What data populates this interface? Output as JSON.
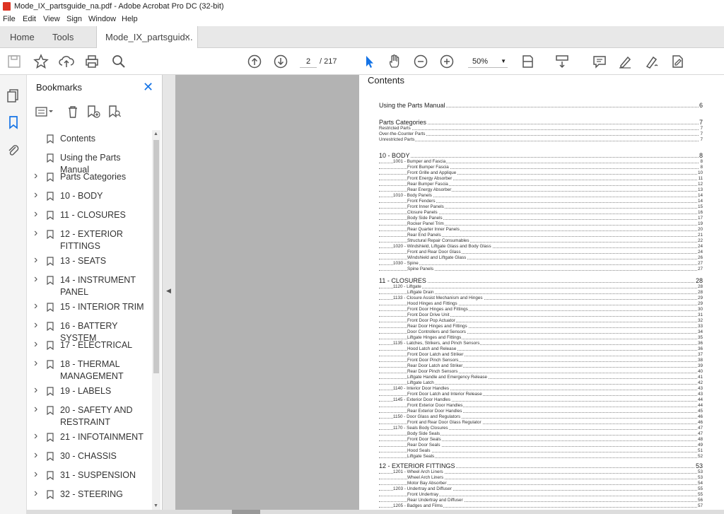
{
  "window": {
    "title": "Mode_IX_partsguide_na.pdf - Adobe Acrobat Pro DC (32-bit)"
  },
  "menu": [
    "File",
    "Edit",
    "View",
    "Sign",
    "Window",
    "Help"
  ],
  "tabs": {
    "home": "Home",
    "tools": "Tools",
    "document": "Mode_IX_partsguid...",
    "close": "×"
  },
  "toolbar": {
    "page_current": "2",
    "page_total": "/ 217",
    "zoom": "50%"
  },
  "bookmarks": {
    "header": "Bookmarks",
    "items": [
      {
        "label": "Contents",
        "expandable": false
      },
      {
        "label": "Using the Parts Manual",
        "expandable": false
      },
      {
        "label": "Parts Categories",
        "expandable": true
      },
      {
        "label": "10 - BODY",
        "expandable": true
      },
      {
        "label": "11 - CLOSURES",
        "expandable": true
      },
      {
        "label": "12 - EXTERIOR FITTINGS",
        "expandable": true
      },
      {
        "label": "13 - SEATS",
        "expandable": true
      },
      {
        "label": "14 - INSTRUMENT PANEL",
        "expandable": true
      },
      {
        "label": "15 - INTERIOR TRIM",
        "expandable": true
      },
      {
        "label": "16 - BATTERY SYSTEM",
        "expandable": true
      },
      {
        "label": "17 - ELECTRICAL",
        "expandable": true
      },
      {
        "label": "18 - THERMAL MANAGEMENT",
        "expandable": true
      },
      {
        "label": "19 - LABELS",
        "expandable": true
      },
      {
        "label": "20 - SAFETY AND RESTRAINT",
        "expandable": true
      },
      {
        "label": "21 - INFOTAINMENT",
        "expandable": true
      },
      {
        "label": "30 - CHASSIS",
        "expandable": true
      },
      {
        "label": "31 - SUSPENSION",
        "expandable": true
      },
      {
        "label": "32 - STEERING",
        "expandable": true
      }
    ]
  },
  "document": {
    "heading": "Contents",
    "sections": [
      {
        "rows": [
          {
            "t": "Using the Parts Manual",
            "p": "6",
            "lvl": "big"
          }
        ]
      },
      {
        "rows": [
          {
            "t": "Parts Categories",
            "p": "7",
            "lvl": "big"
          },
          {
            "t": "Restricted Parts",
            "p": "7",
            "lvl": "l0"
          },
          {
            "t": "Over-the-Counter Parts",
            "p": "7",
            "lvl": "l0"
          },
          {
            "t": "Unrestricted Parts",
            "p": "7",
            "lvl": "l0"
          }
        ]
      },
      {
        "rows": [
          {
            "t": "10 - BODY",
            "p": "8",
            "lvl": "big"
          },
          {
            "t": "1001 - Bumper and Fascia",
            "p": "8",
            "lvl": "l1"
          },
          {
            "t": "Front Bumper Fascia",
            "p": "8",
            "lvl": "l2"
          },
          {
            "t": "Front Grille and Applique",
            "p": "10",
            "lvl": "l2"
          },
          {
            "t": "Front Energy Absorber",
            "p": "11",
            "lvl": "l2"
          },
          {
            "t": "Rear Bumper Fascia",
            "p": "12",
            "lvl": "l2"
          },
          {
            "t": "Rear Energy Absorber",
            "p": "13",
            "lvl": "l2"
          },
          {
            "t": "1010 - Body Panels",
            "p": "14",
            "lvl": "l1"
          },
          {
            "t": "Front Fenders",
            "p": "14",
            "lvl": "l2"
          },
          {
            "t": "Front Inner Panels",
            "p": "15",
            "lvl": "l2"
          },
          {
            "t": "Closure Panels",
            "p": "16",
            "lvl": "l2"
          },
          {
            "t": "Body Side Panels",
            "p": "17",
            "lvl": "l2"
          },
          {
            "t": "Rocker Panel Trim",
            "p": "19",
            "lvl": "l2"
          },
          {
            "t": "Rear Quarter Inner Panels",
            "p": "20",
            "lvl": "l2"
          },
          {
            "t": "Rear End Panels",
            "p": "21",
            "lvl": "l2"
          },
          {
            "t": "Structural Repair Consumables",
            "p": "22",
            "lvl": "l2"
          },
          {
            "t": "1020 - Windshield, Liftgate Glass and Body Glass",
            "p": "24",
            "lvl": "l1"
          },
          {
            "t": "Front and Rear Door Glass",
            "p": "24",
            "lvl": "l2"
          },
          {
            "t": "Windshield and Liftgate Glass",
            "p": "26",
            "lvl": "l2"
          },
          {
            "t": "1030 - Spine",
            "p": "27",
            "lvl": "l1"
          },
          {
            "t": "Spine Panels",
            "p": "27",
            "lvl": "l2"
          }
        ]
      },
      {
        "rows": [
          {
            "t": "11 - CLOSURES",
            "p": "28",
            "lvl": "big"
          },
          {
            "t": "1120 - Liftgate",
            "p": "28",
            "lvl": "l1"
          },
          {
            "t": "Liftgate Drain",
            "p": "28",
            "lvl": "l2"
          },
          {
            "t": "1133 - Closure Assist Mechanism and Hinges",
            "p": "29",
            "lvl": "l1"
          },
          {
            "t": "Hood Hinges and Fittings",
            "p": "29",
            "lvl": "l2"
          },
          {
            "t": "Front Door Hinges and Fittings",
            "p": "30",
            "lvl": "l2"
          },
          {
            "t": "Front Door Drive Unit",
            "p": "31",
            "lvl": "l2"
          },
          {
            "t": "Front Door Pop Actuator",
            "p": "32",
            "lvl": "l2"
          },
          {
            "t": "Rear Door Hinges and Fittings",
            "p": "33",
            "lvl": "l2"
          },
          {
            "t": "Door Controllers and Sensors",
            "p": "34",
            "lvl": "l2"
          },
          {
            "t": "Liftgate Hinges and Fittings",
            "p": "35",
            "lvl": "l2"
          },
          {
            "t": "1135 - Latches, Strikers, and Pinch Sensors",
            "p": "36",
            "lvl": "l1"
          },
          {
            "t": "Hood Latch and Release",
            "p": "36",
            "lvl": "l2"
          },
          {
            "t": "Front Door Latch and Striker",
            "p": "37",
            "lvl": "l2"
          },
          {
            "t": "Front Door Pinch Sensors",
            "p": "38",
            "lvl": "l2"
          },
          {
            "t": "Rear Door Latch and Striker",
            "p": "39",
            "lvl": "l2"
          },
          {
            "t": "Rear Door Pinch Sensors",
            "p": "40",
            "lvl": "l2"
          },
          {
            "t": "Liftgate Handle and Emergency Release",
            "p": "41",
            "lvl": "l2"
          },
          {
            "t": "Liftgate Latch",
            "p": "42",
            "lvl": "l2"
          },
          {
            "t": "1140 - Interior Door Handles",
            "p": "43",
            "lvl": "l1"
          },
          {
            "t": "Front Door Latch and Interior Release",
            "p": "43",
            "lvl": "l2"
          },
          {
            "t": "1145 - Exterior Door Handles",
            "p": "44",
            "lvl": "l1"
          },
          {
            "t": "Front Exterior Door Handles",
            "p": "44",
            "lvl": "l2"
          },
          {
            "t": "Rear Exterior Door Handles",
            "p": "45",
            "lvl": "l2"
          },
          {
            "t": "1150 - Door Glass and Regulators",
            "p": "46",
            "lvl": "l1"
          },
          {
            "t": "Front and Rear Door Glass Regulator",
            "p": "46",
            "lvl": "l2"
          },
          {
            "t": "1170 - Seals Body Closures",
            "p": "47",
            "lvl": "l1"
          },
          {
            "t": "Body Side Seals",
            "p": "47",
            "lvl": "l2"
          },
          {
            "t": "Front Door Seals",
            "p": "48",
            "lvl": "l2"
          },
          {
            "t": "Rear Door Seals",
            "p": "49",
            "lvl": "l2"
          },
          {
            "t": "Hood Seals",
            "p": "51",
            "lvl": "l2"
          },
          {
            "t": "Liftgate Seals",
            "p": "52",
            "lvl": "l2"
          }
        ]
      },
      {
        "rows": [
          {
            "t": "12 - EXTERIOR FITTINGS",
            "p": "53",
            "lvl": "big"
          },
          {
            "t": "1201 - Wheel Arch Liners",
            "p": "53",
            "lvl": "l1"
          },
          {
            "t": "Wheel Arch Liners",
            "p": "53",
            "lvl": "l2"
          },
          {
            "t": "Motor Bay Absorber",
            "p": "54",
            "lvl": "l2"
          },
          {
            "t": "1203 - Undertray and Diffuser",
            "p": "55",
            "lvl": "l1"
          },
          {
            "t": "Front Undertray",
            "p": "55",
            "lvl": "l2"
          },
          {
            "t": "Rear Undertray and Diffuser",
            "p": "56",
            "lvl": "l2"
          },
          {
            "t": "1205 - Badges and Films",
            "p": "57",
            "lvl": "l1"
          }
        ]
      }
    ]
  }
}
